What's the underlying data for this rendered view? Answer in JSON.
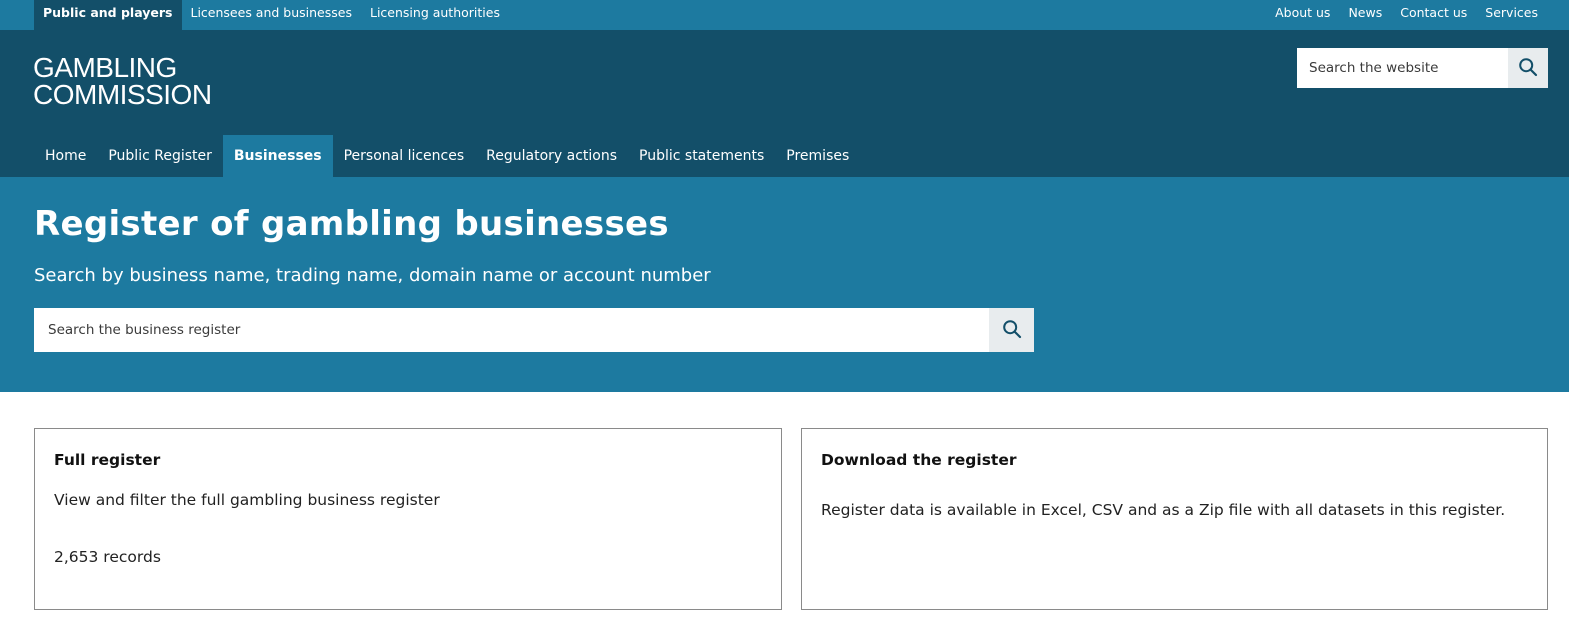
{
  "utility": {
    "tabs": [
      {
        "label": "Public and players"
      },
      {
        "label": "Licensees and businesses"
      },
      {
        "label": "Licensing authorities"
      }
    ],
    "links": [
      {
        "label": "About us"
      },
      {
        "label": "News"
      },
      {
        "label": "Contact us"
      },
      {
        "label": "Services"
      }
    ]
  },
  "header": {
    "logo_line1": "GAMBLING",
    "logo_line2": "COMMISSION",
    "search_placeholder": "Search the website"
  },
  "nav": {
    "items": [
      {
        "label": "Home"
      },
      {
        "label": "Public Register"
      },
      {
        "label": "Businesses"
      },
      {
        "label": "Personal licences"
      },
      {
        "label": "Regulatory actions"
      },
      {
        "label": "Public statements"
      },
      {
        "label": "Premises"
      }
    ]
  },
  "hero": {
    "title": "Register of gambling businesses",
    "subtitle": "Search by business name, trading name, domain name or account number",
    "search_placeholder": "Search the business register"
  },
  "cards": {
    "full_register": {
      "title": "Full register",
      "description": "View and filter the full gambling business register",
      "count": "2,653 records"
    },
    "download": {
      "title": "Download the register",
      "description": "Register data is available in Excel, CSV and as a Zip file with all datasets in this register."
    }
  },
  "colors": {
    "utility_bar": "#1d7aa0",
    "header": "#134f69",
    "hero": "#1d7aa0",
    "search_button": "#e8ecee"
  },
  "icons": {
    "site_search": "search-icon",
    "register_search": "search-icon"
  }
}
